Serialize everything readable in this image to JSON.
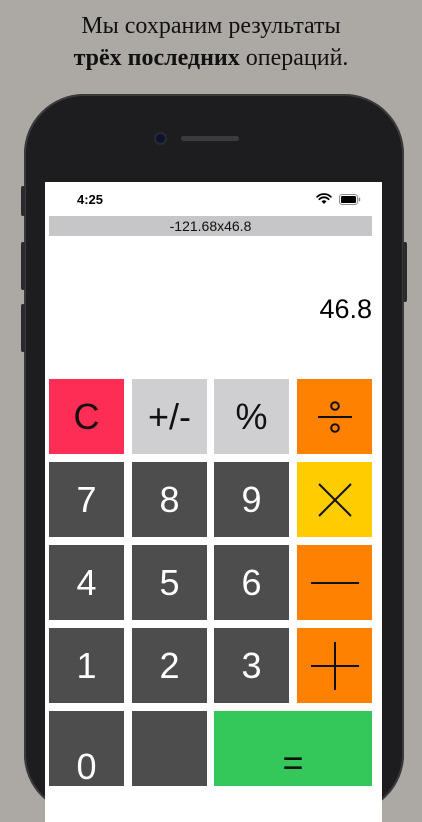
{
  "headline": {
    "line1": "Мы сохраним результаты",
    "bold": "трёх последних",
    "rest": " операций."
  },
  "status_bar": {
    "time": "4:25",
    "wifi_icon": "wifi-icon",
    "battery_icon": "battery-icon"
  },
  "calculator": {
    "history": "-121.68x46.8",
    "display": "46.8",
    "keys": {
      "clear": "C",
      "sign": "+/-",
      "percent": "%",
      "divide_icon": "divide-icon",
      "seven": "7",
      "eight": "8",
      "nine": "9",
      "multiply_icon": "multiply-icon",
      "four": "4",
      "five": "5",
      "six": "6",
      "minus_icon": "minus-icon",
      "one": "1",
      "two": "2",
      "three": "3",
      "plus_icon": "plus-icon",
      "zero": "0",
      "equals": "="
    }
  },
  "colors": {
    "background": "#aca8a4",
    "clear_key": "#fe2d55",
    "operator_key": "#fe8102",
    "multiply_key": "#ffcc00",
    "equals_key": "#34c759",
    "digit_key": "#4d4d4d",
    "function_key": "#cfcfd1"
  }
}
